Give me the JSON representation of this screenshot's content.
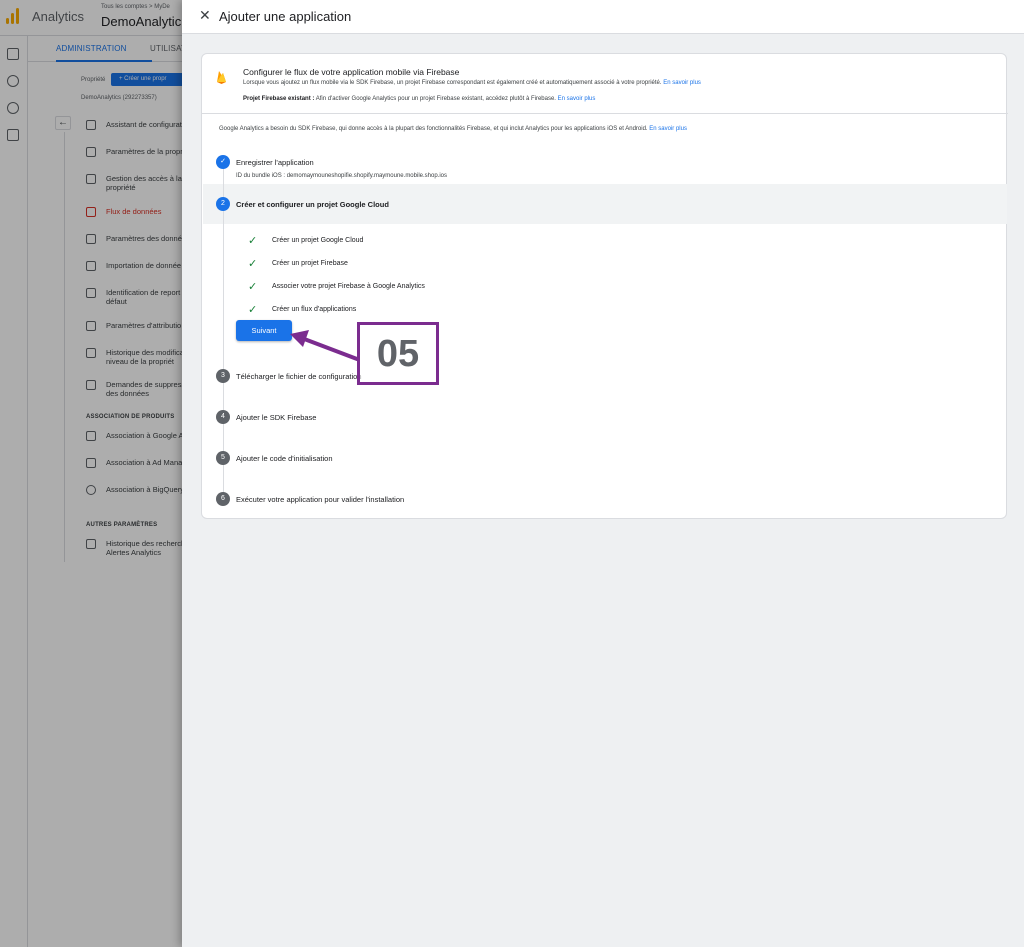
{
  "background": {
    "app_name": "Analytics",
    "breadcrumb": "Tous les comptes > MyDe",
    "account_name": "DemoAnalytic",
    "tabs": {
      "admin": "ADMINISTRATION",
      "user": "UTILISAT"
    },
    "property_label": "Propriété",
    "create_property_button": "+ Créer une propr",
    "property_id": "DemoAnalytics (292273357)",
    "nav_items": [
      "Assistant de configurat",
      "Paramètres de la propri",
      "Gestion des accès à la propriété",
      "Flux de données",
      "Paramètres des donné",
      "Importation de donnée",
      "Identification de report par défaut",
      "Paramètres d'attributio",
      "Historique des modifica au niveau de la propriét",
      "Demandes de suppress des données"
    ],
    "section_products": "ASSOCIATION DE PRODUITS",
    "product_links": [
      "Association à Google A",
      "Association à Ad Mana",
      "Association à BigQuery"
    ],
    "section_other": "AUTRES PARAMÈTRES",
    "other_items": [
      "Historique des recherch Alertes Analytics"
    ]
  },
  "panel": {
    "title": "Ajouter une application",
    "firebase_box": {
      "title": "Configurer le flux de votre application mobile via Firebase",
      "description": "Lorsque vous ajoutez un flux mobile via le SDK Firebase, un projet Firebase correspondant est également créé et automatiquement associé à votre propriété.",
      "learn_more": "En savoir plus",
      "existing_label": "Projet Firebase existant :",
      "existing_text": "Afin d'activer Google Analytics pour un projet Firebase existant, accédez plutôt à Firebase.",
      "existing_link": "En savoir plus"
    },
    "intro": "Google Analytics a besoin du SDK Firebase, qui donne accès à la plupart des fonctionnalités Firebase, et qui inclut Analytics pour les applications iOS et Android.",
    "intro_link": "En savoir plus",
    "steps": [
      {
        "number": "✓",
        "label": "Enregistrer l'application",
        "sub": "ID du bundle iOS : demomaymouneshopifie.shopify.maymoune.mobile.shop.ios"
      },
      {
        "number": "2",
        "label": "Créer et configurer un projet Google Cloud"
      },
      {
        "number": "3",
        "label": "Télécharger le fichier de configuration"
      },
      {
        "number": "4",
        "label": "Ajouter le SDK Firebase"
      },
      {
        "number": "5",
        "label": "Ajouter le code d'initialisation"
      },
      {
        "number": "6",
        "label": "Exécuter votre application pour valider l'installation"
      }
    ],
    "subtasks": [
      "Créer un projet Google Cloud",
      "Créer un projet Firebase",
      "Associer votre projet Firebase à Google Analytics",
      "Créer un flux d'applications"
    ],
    "next_button": "Suivant"
  },
  "annotation": {
    "label": "05",
    "color": "#7b2c8f"
  }
}
